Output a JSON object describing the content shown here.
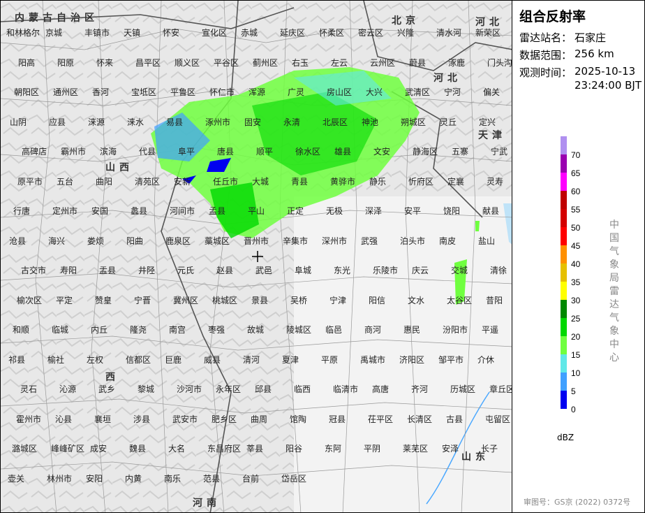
{
  "panel": {
    "title": "组合反射率",
    "station_label": "雷达站名：",
    "station": "石家庄",
    "range_label": "数据范围：",
    "range": "256 km",
    "time_label": "观测时间：",
    "date": "2025-10-13",
    "time": "23:24:00 BJT",
    "unit": "dBZ",
    "organization": "中国气象局雷达气象中心",
    "copyright": "审图号：GS京 (2022) 0372号"
  },
  "legend": {
    "labels": [
      "70",
      "65",
      "60",
      "55",
      "50",
      "45",
      "40",
      "35",
      "30",
      "25",
      "20",
      "15",
      "10",
      "5",
      "0"
    ],
    "colors": [
      "#b090f0",
      "#9a00b0",
      "#ff00ff",
      "#c00000",
      "#d40000",
      "#ff0000",
      "#ff9000",
      "#e6c000",
      "#ffff00",
      "#008800",
      "#00d800",
      "#70ff40",
      "#60e8e8",
      "#40a0ff",
      "#0000f0"
    ]
  },
  "map": {
    "provinces": [
      "内蒙古自治区",
      "北京",
      "河北",
      "天津",
      "山西",
      "河北",
      "西",
      "山东",
      "河南"
    ],
    "places": [
      "和林格尔",
      "京城",
      "丰镇市",
      "天镇",
      "怀安",
      "宣化区",
      "赤城",
      "延庆区",
      "怀柔区",
      "密云区",
      "兴隆",
      "清水河",
      "新荣区",
      "阳高",
      "阳原",
      "怀来",
      "昌平区",
      "顺义区",
      "平谷区",
      "蓟州区",
      "右玉",
      "左云",
      "云州区",
      "蔚县",
      "涿鹿",
      "门头沟区",
      "朝阳区",
      "通州区",
      "香河",
      "宝坻区",
      "平鲁区",
      "怀仁市",
      "浑源",
      "广灵",
      "房山区",
      "大兴",
      "武清区",
      "宁河",
      "偏关",
      "山阴",
      "应县",
      "涞源",
      "涞水",
      "易县",
      "涿州市",
      "固安",
      "永清",
      "北辰区",
      "神池",
      "朔城区",
      "灵丘",
      "定兴",
      "高碑店",
      "霸州市",
      "滨海",
      "代县",
      "阜平",
      "唐县",
      "顺平",
      "徐水区",
      "雄县",
      "文安",
      "静海区",
      "五寨",
      "宁武",
      "原平市",
      "五台",
      "曲阳",
      "清苑区",
      "安新",
      "任丘市",
      "大城",
      "青县",
      "黄骅市",
      "静乐",
      "忻府区",
      "定襄",
      "灵寿",
      "行唐",
      "定州市",
      "安国",
      "蠡县",
      "河间市",
      "孟县",
      "平山",
      "正定",
      "无极",
      "深泽",
      "安平",
      "饶阳",
      "献县",
      "沧县",
      "海兴",
      "娄烦",
      "阳曲",
      "鹿泉区",
      "藁城区",
      "晋州市",
      "辛集市",
      "深州市",
      "武强",
      "泊头市",
      "南皮",
      "盐山",
      "古交市",
      "寿阳",
      "盂县",
      "井陉",
      "元氏",
      "赵县",
      "武邑",
      "阜城",
      "东光",
      "乐陵市",
      "庆云",
      "交城",
      "清徐",
      "榆次区",
      "平定",
      "赞皇",
      "宁晋",
      "冀州区",
      "桃城区",
      "景县",
      "吴桥",
      "宁津",
      "阳信",
      "文水",
      "太谷区",
      "昔阳",
      "和顺",
      "临城",
      "内丘",
      "隆尧",
      "南宫",
      "枣强",
      "故城",
      "陵城区",
      "临邑",
      "商河",
      "惠民",
      "汾阳市",
      "平遥",
      "祁县",
      "榆社",
      "左权",
      "信都区",
      "巨鹿",
      "威县",
      "清河",
      "夏津",
      "平原",
      "禹城市",
      "济阳区",
      "邹平市",
      "介休",
      "灵石",
      "沁源",
      "武乡",
      "黎城",
      "沙河市",
      "永年区",
      "邱县",
      "临西",
      "临清市",
      "高唐",
      "齐河",
      "历城区",
      "章丘区",
      "霍州市",
      "沁县",
      "襄垣",
      "涉县",
      "武安市",
      "肥乡区",
      "曲周",
      "馆陶",
      "冠县",
      "茌平区",
      "长清区",
      "古县",
      "屯留区",
      "潞城区",
      "峰峰矿区",
      "成安",
      "魏县",
      "大名",
      "东昌府区",
      "莘县",
      "阳谷",
      "东阿",
      "平阴",
      "莱芜区",
      "安泽",
      "长子",
      "壶关",
      "林州市",
      "安阳",
      "内黄",
      "南乐",
      "范县",
      "台前",
      "岱岳区"
    ]
  }
}
